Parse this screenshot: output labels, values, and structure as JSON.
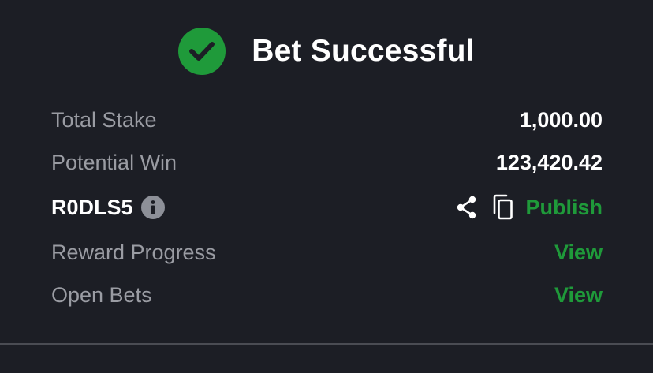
{
  "header": {
    "title": "Bet Successful",
    "icon": "check-circle-icon"
  },
  "summary": {
    "total_stake": {
      "label": "Total Stake",
      "value": "1,000.00"
    },
    "potential_win": {
      "label": "Potential Win",
      "value": "123,420.42"
    },
    "booking": {
      "code": "R0DLS5",
      "info_icon": "info-icon",
      "share_icon": "share-icon",
      "copy_icon": "copy-icon",
      "publish_label": "Publish"
    },
    "reward_progress": {
      "label": "Reward Progress",
      "link": "View"
    },
    "open_bets": {
      "label": "Open Bets",
      "link": "View"
    }
  },
  "colors": {
    "background": "#1c1e25",
    "accent_green": "#1f9a3a",
    "label_gray": "#9a9ca3",
    "divider": "#4a4c53"
  }
}
